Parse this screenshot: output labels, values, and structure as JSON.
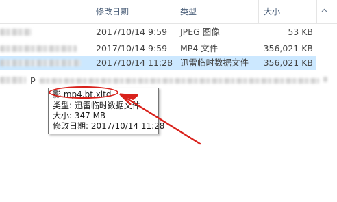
{
  "columns": {
    "date": "修改日期",
    "type": "类型",
    "size": "大小"
  },
  "rows": [
    {
      "name": "",
      "date": "2017/10/14 9:59",
      "type": "JPEG 图像",
      "size": "53 KB",
      "selected": false
    },
    {
      "name": "",
      "date": "2017/10/14 9:59",
      "type": "MP4 文件",
      "size": "356,021 KB",
      "selected": false
    },
    {
      "name": "",
      "date": "2017/10/14 11:28",
      "type": "迅雷临时数据文件",
      "size": "356,021 KB",
      "selected": true
    }
  ],
  "partial_row": {
    "fragment": "p"
  },
  "tooltip": {
    "filename": "影.mp4.bt.xltd",
    "type_line": "类型: 迅雷临时数据文件",
    "size_line": "大小: 347 MB",
    "modified_line": "修改日期: 2017/10/14 11:28"
  },
  "colors": {
    "selection": "#cce8ff",
    "annotation": "#d9221c",
    "header_text": "#4c607a"
  }
}
